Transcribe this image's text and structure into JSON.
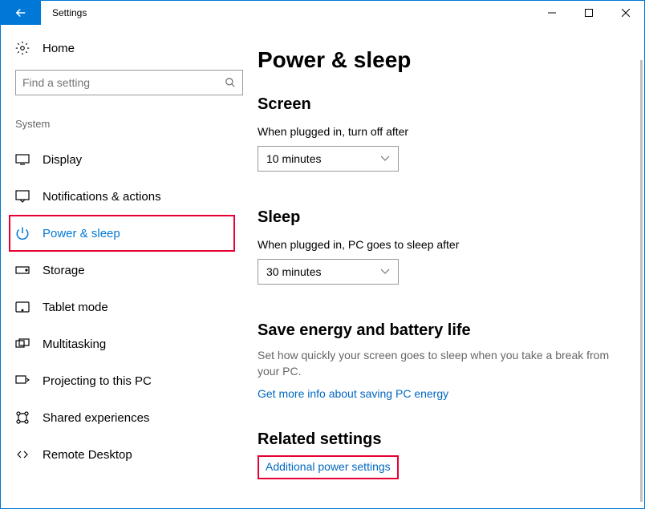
{
  "titlebar": {
    "title": "Settings"
  },
  "sidebar": {
    "home": "Home",
    "search_placeholder": "Find a setting",
    "group": "System",
    "items": [
      {
        "label": "Display"
      },
      {
        "label": "Notifications & actions"
      },
      {
        "label": "Power & sleep"
      },
      {
        "label": "Storage"
      },
      {
        "label": "Tablet mode"
      },
      {
        "label": "Multitasking"
      },
      {
        "label": "Projecting to this PC"
      },
      {
        "label": "Shared experiences"
      },
      {
        "label": "Remote Desktop"
      }
    ]
  },
  "main": {
    "title": "Power & sleep",
    "screen": {
      "heading": "Screen",
      "label": "When plugged in, turn off after",
      "value": "10 minutes"
    },
    "sleep": {
      "heading": "Sleep",
      "label": "When plugged in, PC goes to sleep after",
      "value": "30 minutes"
    },
    "energy": {
      "heading": "Save energy and battery life",
      "desc": "Set how quickly your screen goes to sleep when you take a break from your PC.",
      "link": "Get more info about saving PC energy"
    },
    "related": {
      "heading": "Related settings",
      "link": "Additional power settings"
    }
  }
}
